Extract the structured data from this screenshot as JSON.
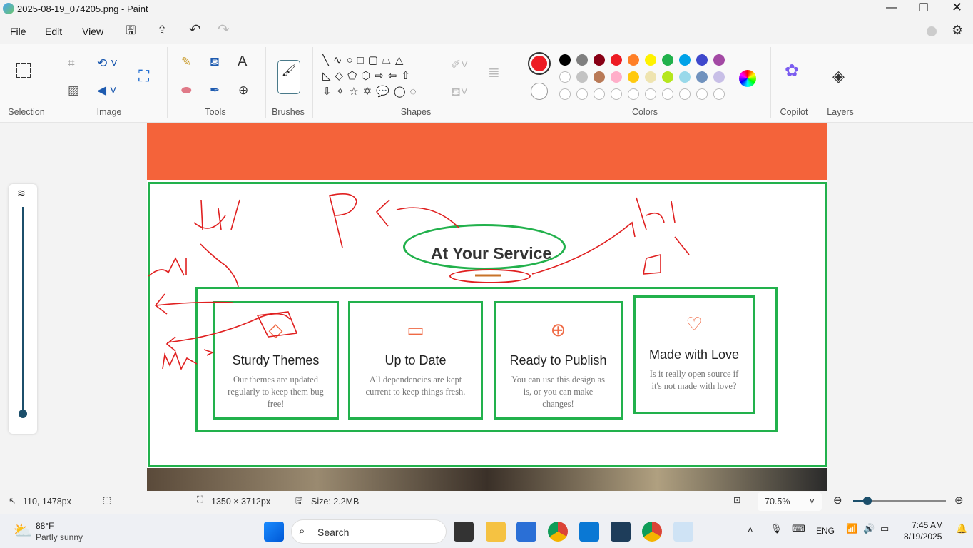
{
  "window": {
    "title": "2025-08-19_074205.png - Paint"
  },
  "menu": {
    "file": "File",
    "edit": "Edit",
    "view": "View"
  },
  "ribbon": {
    "groups": {
      "selection": "Selection",
      "image": "Image",
      "tools": "Tools",
      "brushes": "Brushes",
      "shapes": "Shapes",
      "colors": "Colors",
      "copilot": "Copilot",
      "layers": "Layers"
    }
  },
  "colors": {
    "primary": "#ed1c24",
    "secondary": "#ffffff",
    "row1": [
      "#000000",
      "#7f7f7f",
      "#880015",
      "#ed1c24",
      "#ff7f27",
      "#fff200",
      "#22b14c",
      "#00a2e8",
      "#3f48cc",
      "#a349a4"
    ],
    "row2": [
      "#ffffff",
      "#c3c3c3",
      "#b97a57",
      "#ffaec9",
      "#ffc90e",
      "#efe4b0",
      "#b5e61d",
      "#99d9ea",
      "#7092be",
      "#c8bfe7"
    ]
  },
  "canvas": {
    "heading": "At Your Service",
    "cards": [
      {
        "title": "Sturdy Themes",
        "text": "Our themes are updated regularly to keep them bug free!",
        "icon": "diamond-icon"
      },
      {
        "title": "Up to Date",
        "text": "All dependencies are kept current to keep things fresh.",
        "icon": "laptop-icon"
      },
      {
        "title": "Ready to Publish",
        "text": "You can use this design as is, or you can make changes!",
        "icon": "globe-icon"
      },
      {
        "title": "Made with Love",
        "text": "Is it really open source if it's not made with love?",
        "icon": "heart-icon"
      }
    ]
  },
  "status": {
    "cursor": "110, 1478px",
    "dimensions": "1350 × 3712px",
    "size": "Size: 2.2MB",
    "zoom": "70.5%",
    "zoom_fraction": 0.17
  },
  "taskbar": {
    "temp": "88°F",
    "weather": "Partly sunny",
    "search": "Search",
    "lang": "ENG",
    "time": "7:45 AM",
    "date": "8/19/2025"
  }
}
